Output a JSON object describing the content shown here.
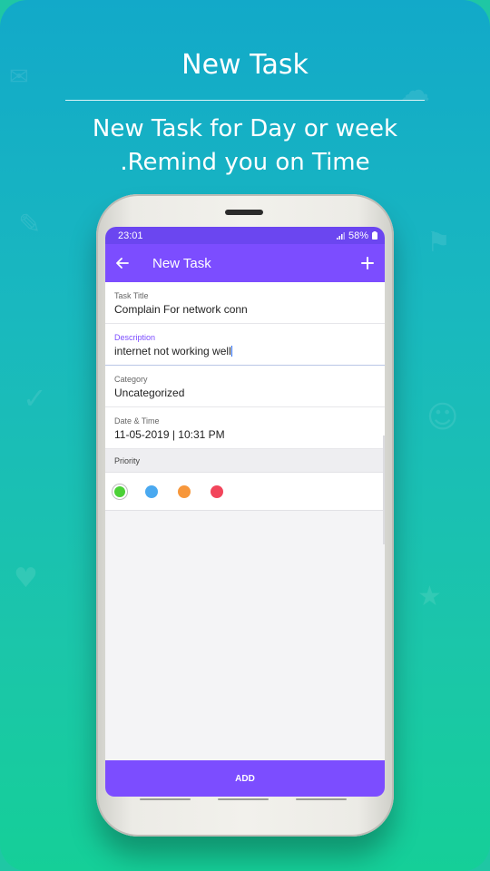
{
  "headline": {
    "title": "New Task",
    "subtitle_line1": "New Task for Day or week",
    "subtitle_line2": ".Remind you on Time"
  },
  "status_bar": {
    "time": "23:01",
    "battery": "58%"
  },
  "app_bar": {
    "title": "New Task",
    "back_icon": "arrow-left-icon",
    "add_icon": "plus-icon"
  },
  "form": {
    "task_title": {
      "label": "Task Title",
      "value": "Complain For network conn"
    },
    "description": {
      "label": "Description",
      "value": "internet not working well"
    },
    "category": {
      "label": "Category",
      "value": "Uncategorized"
    },
    "datetime": {
      "label": "Date & Time",
      "value": "11-05-2019 | 10:31 PM"
    }
  },
  "priority": {
    "label": "Priority",
    "options": [
      {
        "color": "#4cd137",
        "selected": true
      },
      {
        "color": "#4aa9f0",
        "selected": false
      },
      {
        "color": "#f7973b",
        "selected": false
      },
      {
        "color": "#f2455b",
        "selected": false
      }
    ]
  },
  "footer": {
    "add_label": "ADD"
  },
  "colors": {
    "primary": "#7c4dff",
    "status_bar": "#6b46f0",
    "background_top": "#12a9c9",
    "background_bottom": "#15cf98"
  }
}
